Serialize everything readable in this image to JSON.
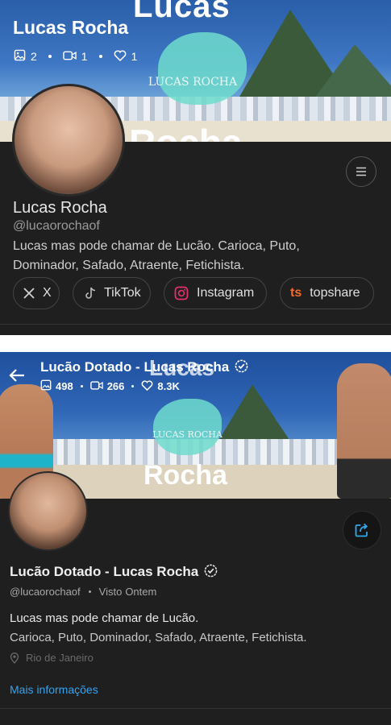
{
  "panel1": {
    "banner_text_top": "Lucas",
    "banner_text_bottom": "Rocha",
    "logo_text": "LUCAS ROCHA",
    "title": "Lucas Rocha",
    "stats": {
      "images": "2",
      "videos": "1",
      "likes": "1"
    },
    "icons": {
      "image": "image-icon",
      "video": "video-icon",
      "heart": "heart-icon",
      "menu": "menu-icon"
    },
    "name": "Lucas Rocha",
    "handle": "@lucaorochaof",
    "bio": "Lucas mas pode chamar de Lucão. Carioca, Puto, Dominador, Safado, Atraente, Fetichista.",
    "links": [
      {
        "label": "X",
        "icon": "x-icon"
      },
      {
        "label": "TikTok",
        "icon": "tiktok-icon"
      },
      {
        "label": "Instagram",
        "icon": "instagram-icon",
        "color": "#e1306c"
      },
      {
        "label": "topshare",
        "icon": "topshare-icon",
        "color": "#f26b2a"
      }
    ]
  },
  "panel2": {
    "banner_text_top": "Lucas",
    "banner_text_bottom": "Rocha",
    "logo_text": "LUCAS ROCHA",
    "title": "Lucão Dotado - Lucas Rocha",
    "stats": {
      "images": "498",
      "videos": "266",
      "likes": "8.3K"
    },
    "name": "Lucão Dotado - Lucas Rocha",
    "handle": "@lucaorochaof",
    "seen_label": "Visto",
    "seen_time": "Ontem",
    "bio_line1": "Lucas mas pode chamar de Lucão.",
    "bio_line2": "Carioca, Puto, Dominador, Safado, Atraente, Fetichista.",
    "location": "Rio de Janeiro",
    "more_info": "Mais informações",
    "accent": "#36a3ee"
  }
}
